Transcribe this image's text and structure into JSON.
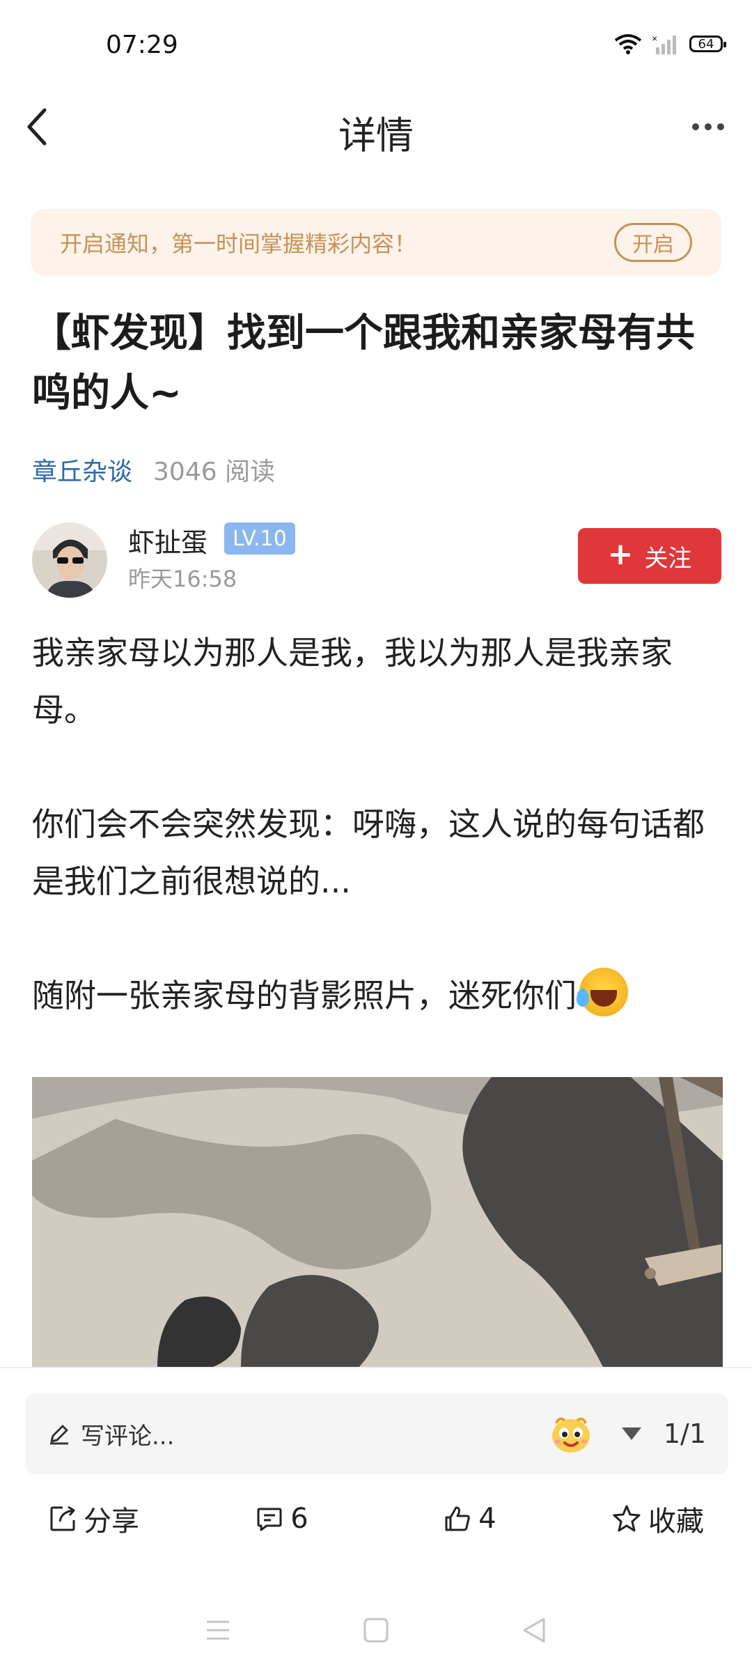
{
  "status_bar": {
    "time": "07:29",
    "battery": "64"
  },
  "header": {
    "title": "详情"
  },
  "notify_banner": {
    "text": "开启通知，第一时间掌握精彩内容！",
    "button": "开启"
  },
  "post": {
    "title": "【虾发现】找到一个跟我和亲家母有共鸣的人~",
    "topic": "章丘杂谈",
    "reads": "3046 阅读",
    "author": {
      "name": "虾扯蛋",
      "level": "LV.10",
      "time": "昨天16:58"
    },
    "follow_label": "关注",
    "paragraphs": [
      "我亲家母以为那人是我，我以为那人是我亲家母。",
      "你们会不会突然发现：呀嗨，这人说的每句话都是我们之前很想说的...",
      "随附一张亲家母的背影照片，迷死你们"
    ]
  },
  "comment_bar": {
    "placeholder": "写评论...",
    "page": "1/1"
  },
  "actions": {
    "share": "分享",
    "comments": "6",
    "likes": "4",
    "favorite": "收藏"
  },
  "colors": {
    "accent_red": "#e0373a",
    "banner_bg": "#fdf3ea",
    "banner_text": "#c79157",
    "link_blue": "#2d6aa8",
    "level_badge": "#8ab7ef"
  }
}
